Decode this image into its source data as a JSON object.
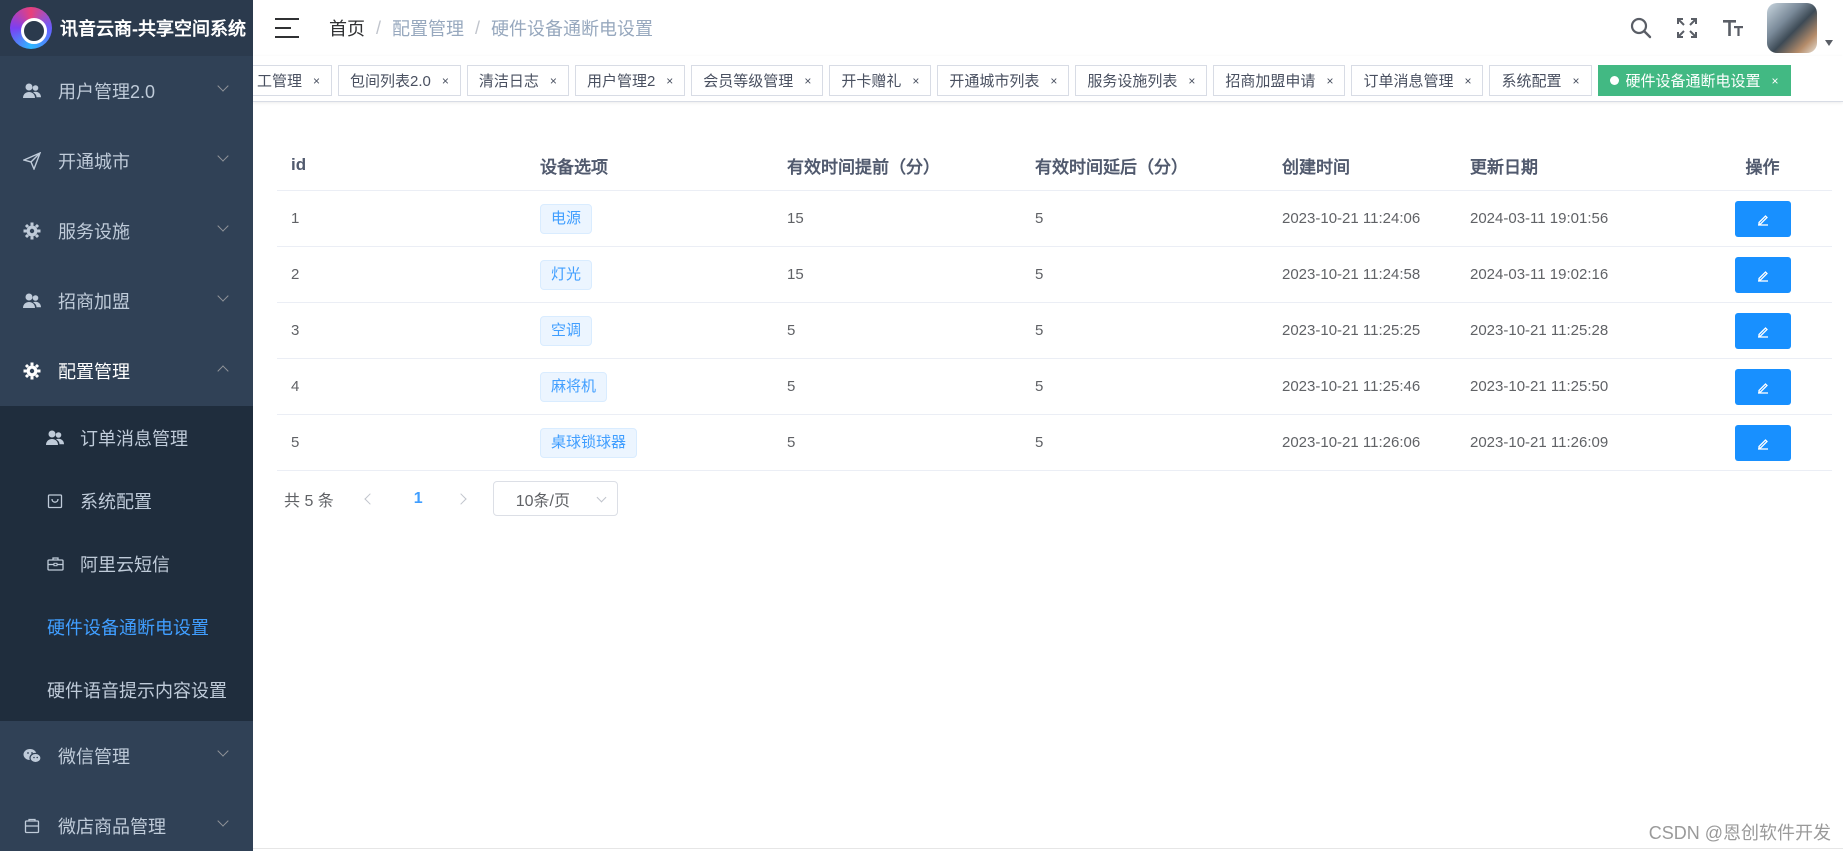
{
  "app": {
    "title": "讯音云商-共享空间系统"
  },
  "sidebar": {
    "items": [
      {
        "label": "用户管理2.0",
        "icon": "user-group-icon"
      },
      {
        "label": "开通城市",
        "icon": "send-icon"
      },
      {
        "label": "服务设施",
        "icon": "gear-icon"
      },
      {
        "label": "招商加盟",
        "icon": "user-group-icon"
      },
      {
        "label": "配置管理",
        "icon": "gear-icon"
      }
    ],
    "submenu": [
      {
        "label": "订单消息管理",
        "icon": "user-group-icon"
      },
      {
        "label": "系统配置",
        "icon": "shopping-bag-icon"
      },
      {
        "label": "阿里云短信",
        "icon": "briefcase-icon"
      },
      {
        "label": "硬件设备通断电设置"
      },
      {
        "label": "硬件语音提示内容设置"
      }
    ],
    "after": [
      {
        "label": "微信管理",
        "icon": "wechat-icon"
      },
      {
        "label": "微店商品管理",
        "icon": "shop-icon"
      }
    ]
  },
  "breadcrumb": [
    "首页",
    "配置管理",
    "硬件设备通断电设置"
  ],
  "tags": [
    "工管理",
    "包间列表2.0",
    "清洁日志",
    "用户管理2",
    "会员等级管理",
    "开卡赠礼",
    "开通城市列表",
    "服务设施列表",
    "招商加盟申请",
    "订单消息管理",
    "系统配置",
    "硬件设备通断电设置"
  ],
  "table": {
    "headers": [
      "id",
      "设备选项",
      "有效时间提前（分）",
      "有效时间延后（分）",
      "创建时间",
      "更新日期",
      "操作"
    ],
    "rows": [
      [
        "1",
        "电源",
        "15",
        "5",
        "2023-10-21 11:24:06",
        "2024-03-11 19:01:56"
      ],
      [
        "2",
        "灯光",
        "15",
        "5",
        "2023-10-21 11:24:58",
        "2024-03-11 19:02:16"
      ],
      [
        "3",
        "空调",
        "5",
        "5",
        "2023-10-21 11:25:25",
        "2023-10-21 11:25:28"
      ],
      [
        "4",
        "麻将机",
        "5",
        "5",
        "2023-10-21 11:25:46",
        "2023-10-21 11:25:50"
      ],
      [
        "5",
        "桌球锁球器",
        "5",
        "5",
        "2023-10-21 11:26:06",
        "2023-10-21 11:26:09"
      ]
    ]
  },
  "pagination": {
    "total": "共 5 条",
    "page": "1",
    "size": "10条/页"
  },
  "watermark": "CSDN @恩创软件开发",
  "colors": {
    "sidebar": "#304156",
    "active_tag": "#42b983",
    "primary": "#1890ff",
    "link": "#409eff"
  }
}
